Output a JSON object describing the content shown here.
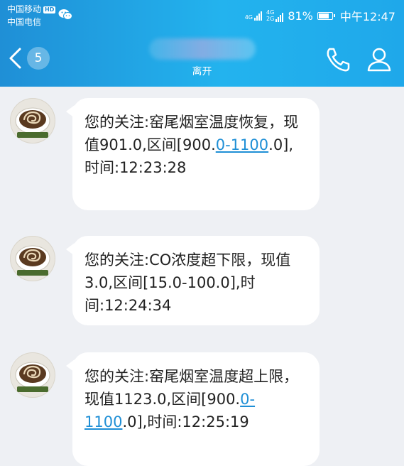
{
  "status_bar": {
    "carrier_primary": "中国移动",
    "hd_badge": "HD",
    "carrier_secondary": "中国电信",
    "net1": "4G",
    "net2_top": "4G",
    "net2_bottom": "2G",
    "battery_percent": "81%",
    "battery_level": 0.81,
    "time": "中午12:47",
    "icons": [
      "wechat-icon",
      "signal-icon",
      "battery-icon"
    ]
  },
  "header": {
    "unread_count": "5",
    "contact_status": "离开",
    "icons": [
      "back-arrow-icon",
      "phone-icon",
      "person-icon"
    ]
  },
  "messages": [
    {
      "text_before": "您的关注:窑尾烟室温度恢复，现值901.0,区间[900.",
      "link": "0-1100",
      "text_after": ".0],时间:12:23:28"
    },
    {
      "text_before": "您的关注:CO浓度超下限，现值3.0,区间[15.0-100.0],时间:12:24:34",
      "link": "",
      "text_after": ""
    },
    {
      "text_before": "您的关注:窑尾烟室温度超上限，现值1123.0,区间[900.",
      "link": "0-1100",
      "text_after": ".0],时间:12:25:19"
    }
  ],
  "colors": {
    "header_gradient_start": "#1f8fd6",
    "header_gradient_end": "#23b3ee",
    "background": "#eef0f4",
    "bubble": "#ffffff",
    "link": "#1f8fd6"
  }
}
